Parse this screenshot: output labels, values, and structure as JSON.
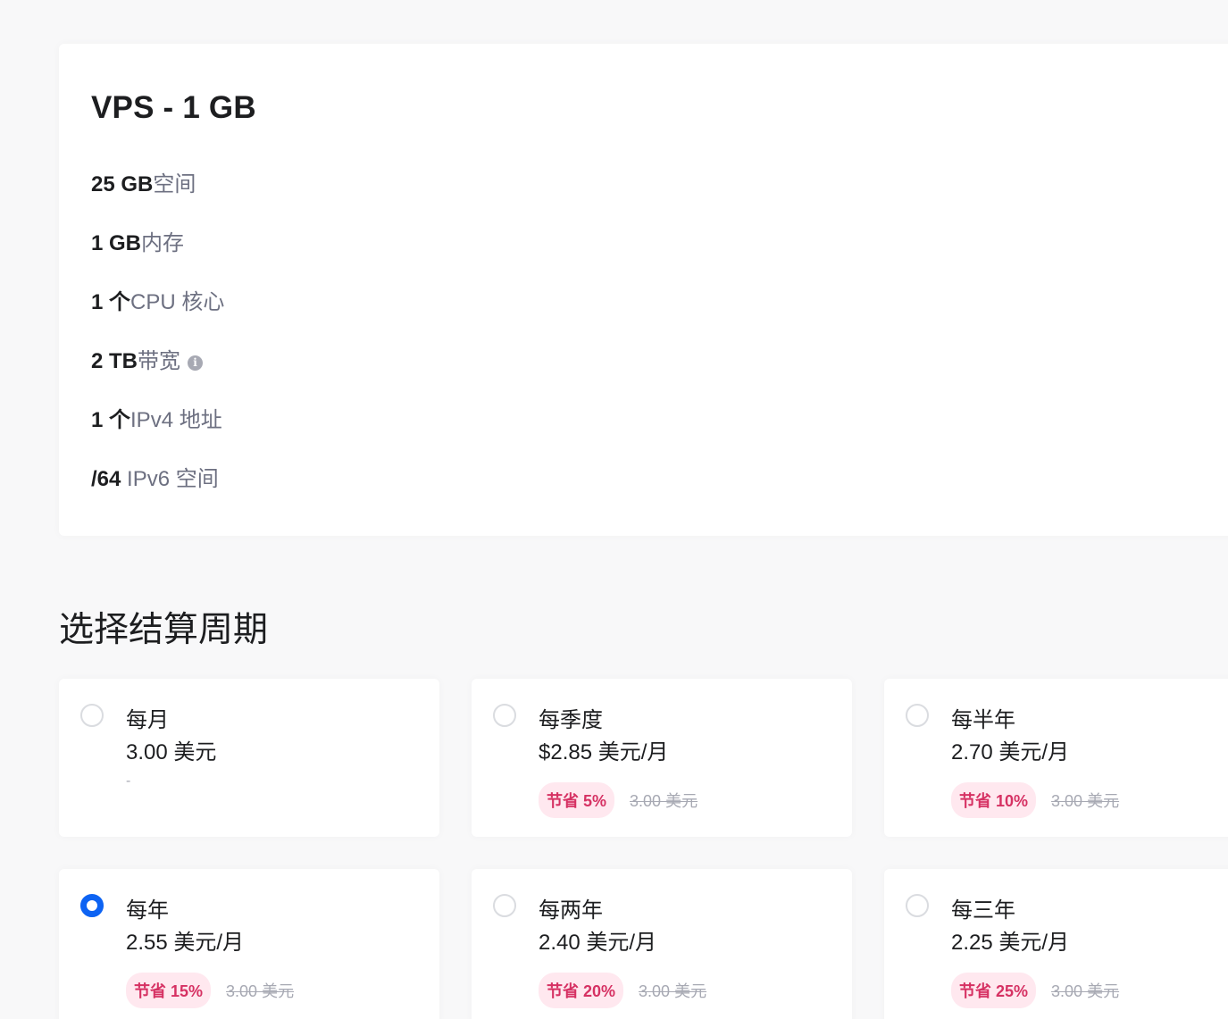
{
  "plan": {
    "title": "VPS - 1 GB",
    "features": [
      {
        "value": "25 GB",
        "label": "空间",
        "info": false
      },
      {
        "value": "1 GB",
        "label": "内存",
        "info": false
      },
      {
        "value": "1 个",
        "label": "CPU 核心",
        "info": false
      },
      {
        "value": "2 TB",
        "label": "带宽",
        "info": true
      },
      {
        "value": "1 个",
        "label": "IPv4 地址",
        "info": false
      },
      {
        "value": "/64",
        "label": " IPv6 空间",
        "info": false
      }
    ]
  },
  "billing": {
    "title": "选择结算周期",
    "options": [
      {
        "name": "每月",
        "price": "3.00 美元",
        "save": "",
        "old_price": "",
        "dash": "-",
        "selected": false
      },
      {
        "name": "每季度",
        "price": "$2.85 美元/月",
        "save": "节省 5%",
        "old_price": "3.00 美元",
        "dash": "",
        "selected": false
      },
      {
        "name": "每半年",
        "price": "2.70 美元/月",
        "save": "节省 10%",
        "old_price": "3.00 美元",
        "dash": "",
        "selected": false
      },
      {
        "name": "每年",
        "price": "2.55 美元/月",
        "save": "节省 15%",
        "old_price": "3.00 美元",
        "dash": "",
        "selected": true
      },
      {
        "name": "每两年",
        "price": "2.40 美元/月",
        "save": "节省 20%",
        "old_price": "3.00 美元",
        "dash": "",
        "selected": false
      },
      {
        "name": "每三年",
        "price": "2.25 美元/月",
        "save": "节省 25%",
        "old_price": "3.00 美元",
        "dash": "",
        "selected": false
      }
    ]
  },
  "colors": {
    "accent": "#0d63f3",
    "save_text": "#d63163",
    "save_bg": "#ffe8ef",
    "muted": "#a7a9b3"
  }
}
